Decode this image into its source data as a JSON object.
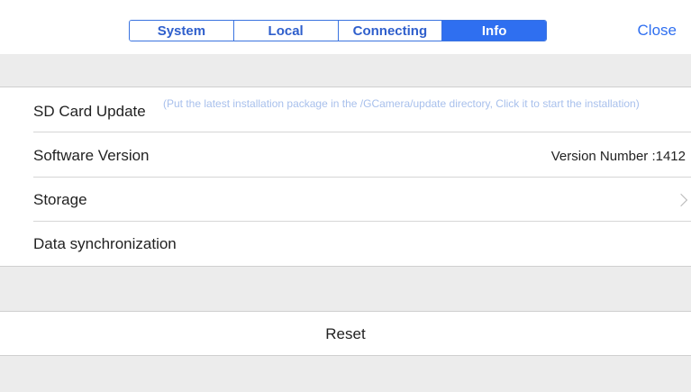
{
  "tabs": [
    {
      "label": "System",
      "active": false
    },
    {
      "label": "Local",
      "active": false
    },
    {
      "label": "Connecting",
      "active": false
    },
    {
      "label": "Info",
      "active": true
    }
  ],
  "close_label": "Close",
  "rows": {
    "sd_card": {
      "label": "SD Card Update",
      "hint": "(Put the latest installation package in the /GCamera/update directory, Click it to start the installation)"
    },
    "software_version": {
      "label": "Software Version",
      "value": "Version Number :1412"
    },
    "storage": {
      "label": "Storage",
      "icon": "chevron-right-icon"
    },
    "data_sync": {
      "label": "Data synchronization"
    }
  },
  "reset_label": "Reset",
  "colors": {
    "accent": "#2f6ff0",
    "hint_text": "#a8c0ec",
    "band": "#ececec"
  }
}
